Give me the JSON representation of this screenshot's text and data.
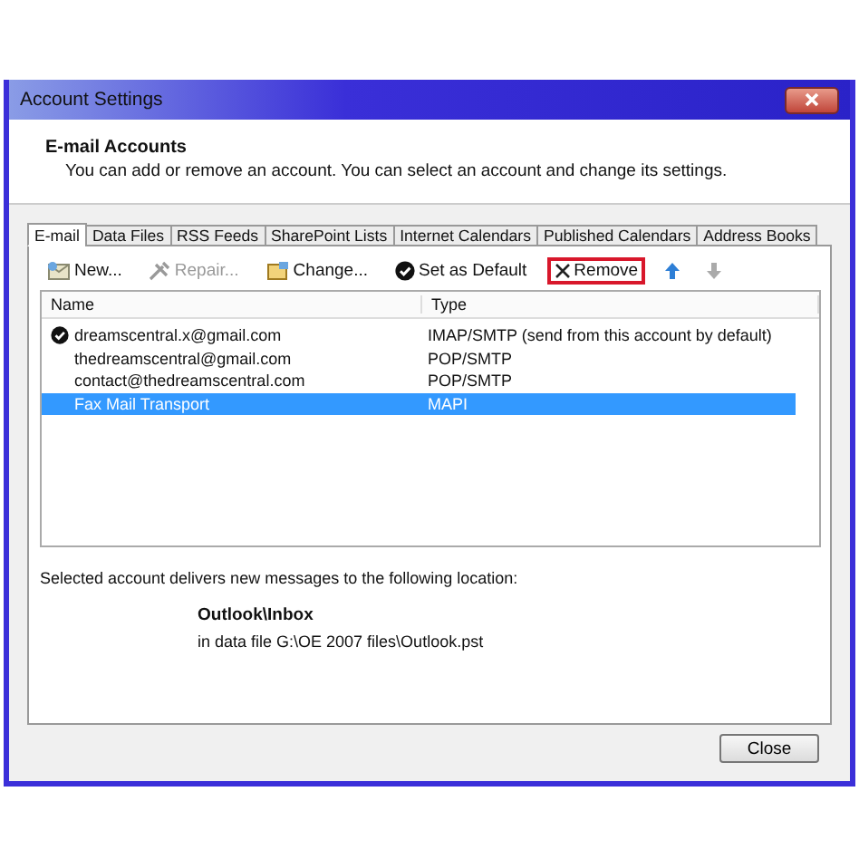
{
  "window": {
    "title": "Account Settings"
  },
  "header": {
    "title": "E-mail Accounts",
    "description": "You can add or remove an account. You can select an account and change its settings."
  },
  "tabs": [
    {
      "label": "E-mail",
      "selected": true
    },
    {
      "label": "Data Files",
      "selected": false
    },
    {
      "label": "RSS Feeds",
      "selected": false
    },
    {
      "label": "SharePoint Lists",
      "selected": false
    },
    {
      "label": "Internet Calendars",
      "selected": false
    },
    {
      "label": "Published Calendars",
      "selected": false
    },
    {
      "label": "Address Books",
      "selected": false
    }
  ],
  "toolbar": [
    {
      "kind": "new",
      "label": "New...",
      "disabled": false,
      "highlighted": false
    },
    {
      "kind": "repair",
      "label": "Repair...",
      "disabled": true,
      "highlighted": false
    },
    {
      "kind": "change",
      "label": "Change...",
      "disabled": false,
      "highlighted": false
    },
    {
      "kind": "default",
      "label": "Set as Default",
      "disabled": false,
      "highlighted": false
    },
    {
      "kind": "remove",
      "label": "Remove",
      "disabled": false,
      "highlighted": true
    },
    {
      "kind": "up",
      "disabled": false,
      "highlighted": false
    },
    {
      "kind": "down",
      "disabled": true,
      "highlighted": false
    }
  ],
  "table": {
    "columns": [
      "Name",
      "Type"
    ],
    "rows": [
      {
        "name": "dreamscentral.x@gmail.com",
        "type": "IMAP/SMTP (send from this account by default)",
        "default": true,
        "selected": false
      },
      {
        "name": "thedreamscentral@gmail.com",
        "type": "POP/SMTP",
        "default": false,
        "selected": false
      },
      {
        "name": "contact@thedreamscentral.com",
        "type": "POP/SMTP",
        "default": false,
        "selected": false
      },
      {
        "name": "Fax Mail Transport",
        "type": "MAPI",
        "default": false,
        "selected": true
      }
    ]
  },
  "delivery": {
    "caption": "Selected account delivers new messages to the following location:",
    "folder": "Outlook\\Inbox",
    "file": "in data file G:\\OE 2007 files\\Outlook.pst"
  },
  "buttons": [
    "Close"
  ]
}
